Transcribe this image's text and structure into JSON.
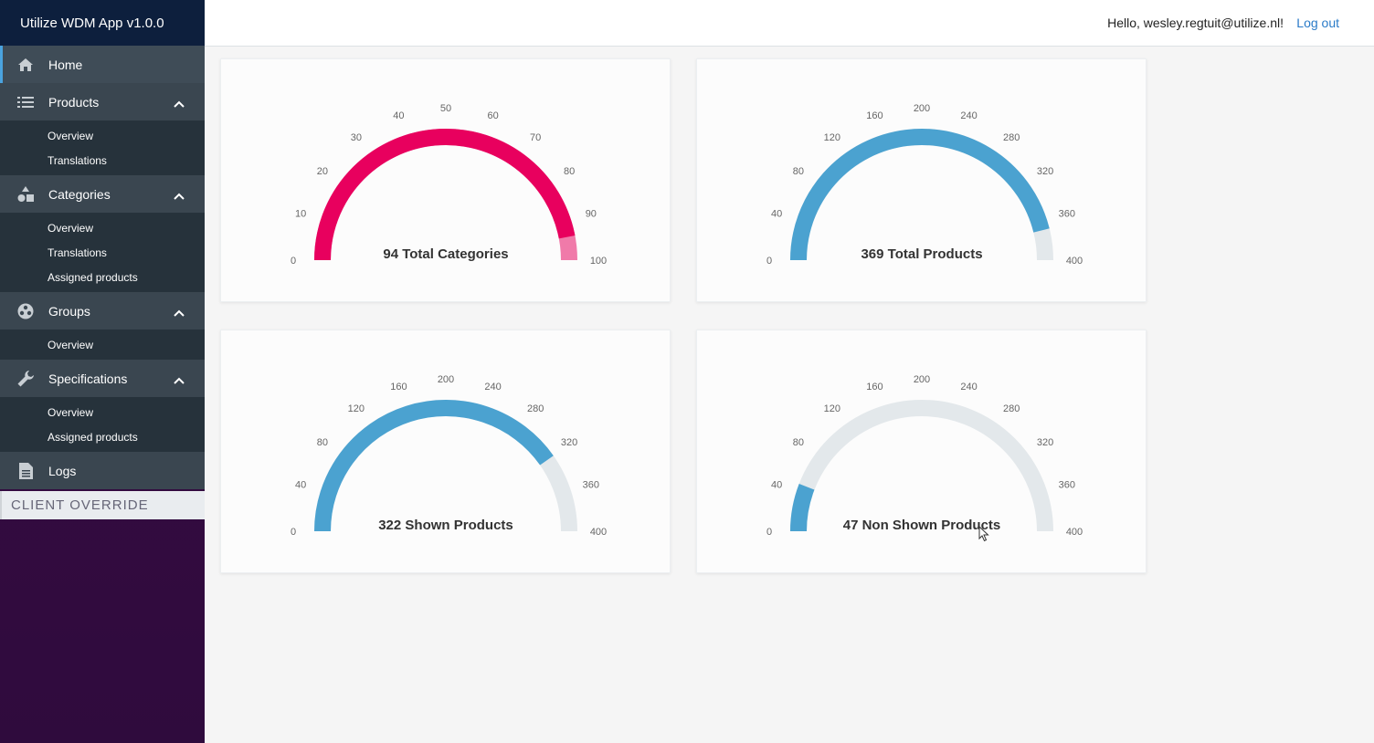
{
  "app": {
    "title": "Utilize WDM App v1.0.0"
  },
  "header": {
    "greeting": "Hello, wesley.regtuit@utilize.nl!",
    "logout": "Log out"
  },
  "sidebar": {
    "home": {
      "label": "Home",
      "icon": "home-icon"
    },
    "products": {
      "label": "Products",
      "icon": "list-icon",
      "items": [
        {
          "label": "Overview"
        },
        {
          "label": "Translations"
        }
      ]
    },
    "categories": {
      "label": "Categories",
      "icon": "shapes-icon",
      "items": [
        {
          "label": "Overview"
        },
        {
          "label": "Translations"
        },
        {
          "label": "Assigned products"
        }
      ]
    },
    "groups": {
      "label": "Groups",
      "icon": "groups-icon",
      "items": [
        {
          "label": "Overview"
        }
      ]
    },
    "specifications": {
      "label": "Specifications",
      "icon": "wrench-icon",
      "items": [
        {
          "label": "Overview"
        },
        {
          "label": "Assigned products"
        }
      ]
    },
    "logs": {
      "label": "Logs",
      "icon": "document-icon"
    },
    "client_override": "CLIENT OVERRIDE"
  },
  "colors": {
    "pink": "#e8005e",
    "blue": "#4ba2d0",
    "track": "#e3e8eb",
    "pink_light": "#f07aa9"
  },
  "chart_data": [
    {
      "type": "gauge",
      "title": "94 Total Categories",
      "value": 94,
      "min": 0,
      "max": 100,
      "ticks": [
        0,
        10,
        20,
        30,
        40,
        50,
        60,
        70,
        80,
        90,
        100
      ],
      "color": "#e8005e",
      "track_color": "#f07aa9"
    },
    {
      "type": "gauge",
      "title": "369 Total Products",
      "value": 369,
      "min": 0,
      "max": 400,
      "ticks": [
        0,
        40,
        80,
        120,
        160,
        200,
        240,
        280,
        320,
        360,
        400
      ],
      "color": "#4ba2d0",
      "track_color": "#e3e8eb"
    },
    {
      "type": "gauge",
      "title": "322 Shown Products",
      "value": 322,
      "min": 0,
      "max": 400,
      "ticks": [
        0,
        40,
        80,
        120,
        160,
        200,
        240,
        280,
        320,
        360,
        400
      ],
      "color": "#4ba2d0",
      "track_color": "#e3e8eb"
    },
    {
      "type": "gauge",
      "title": "47 Non Shown Products",
      "value": 47,
      "min": 0,
      "max": 400,
      "ticks": [
        0,
        40,
        80,
        120,
        160,
        200,
        240,
        280,
        320,
        360,
        400
      ],
      "color": "#4ba2d0",
      "track_color": "#e3e8eb"
    }
  ]
}
